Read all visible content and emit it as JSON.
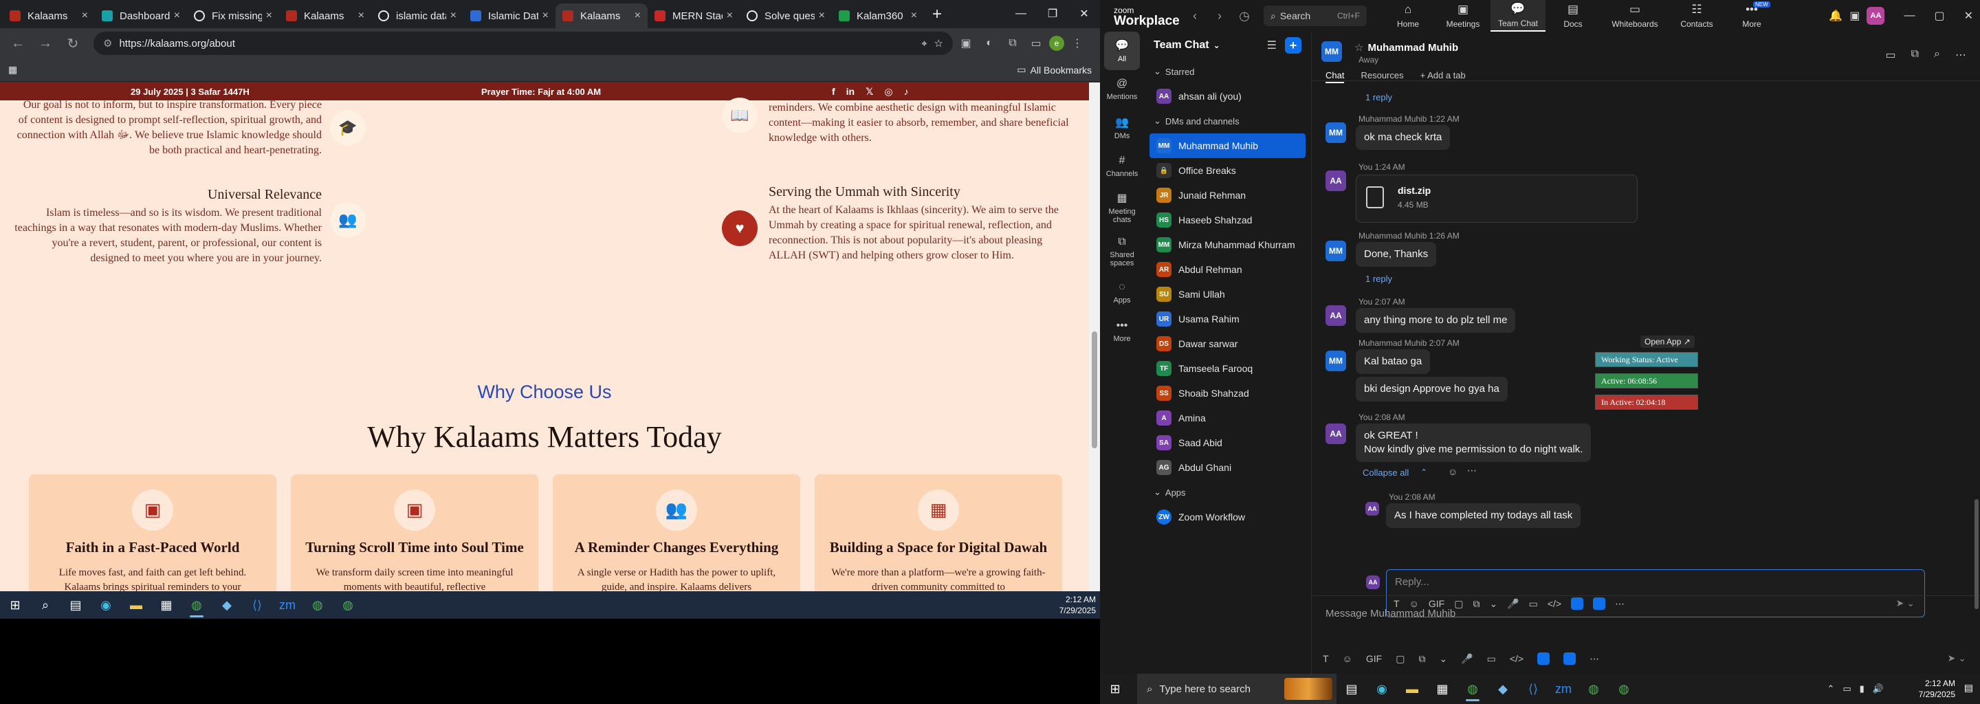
{
  "chrome": {
    "tabs": [
      {
        "label": "Kalaams",
        "favicon_color": "#b02a1e",
        "active": false
      },
      {
        "label": "Dashboard",
        "favicon_color": "#19a1a8",
        "active": false
      },
      {
        "label": "Fix missing",
        "favicon_color": "#e8eaed",
        "active": false
      },
      {
        "label": "Kalaams",
        "favicon_color": "#b02a1e",
        "active": false
      },
      {
        "label": "islamic data",
        "favicon_color": "#e8eaed",
        "active": false
      },
      {
        "label": "Islamic Data",
        "favicon_color": "#2f6bd6",
        "active": false
      },
      {
        "label": "Kalaams",
        "favicon_color": "#b02a1e",
        "active": true
      },
      {
        "label": "MERN Stack",
        "favicon_color": "#c62828",
        "active": false
      },
      {
        "label": "Solve quest",
        "favicon_color": "#e8eaed",
        "active": false
      },
      {
        "label": "Kalam360",
        "favicon_color": "#1e9e4a",
        "active": false
      }
    ],
    "url": "https://kalaams.org/about",
    "bookmarks_label": "All Bookmarks"
  },
  "site": {
    "date": "29 July 2025 | 3 Safar 1447H",
    "prayer": "Prayer Time: Fajr at 4:00 AM",
    "feature_left_top_text": "Our goal is not to inform, but to inspire transformation. Every piece of content is designed to prompt self-reflection, spiritual growth, and connection with Allah ﷻ. We believe true Islamic knowledge should be both practical and heart-penetrating.",
    "feature_right_top_text": "reminders. We combine aesthetic design with meaningful Islamic content—making it easier to absorb, remember, and share beneficial knowledge with others.",
    "universal_title": "Universal Relevance",
    "universal_text": "Islam is timeless—and so is its wisdom. We present traditional teachings in a way that resonates with modern-day Muslims. Whether you're a revert, student, parent, or professional, our content is designed to meet you where you are in your journey.",
    "serving_title": "Serving the Ummah with Sincerity",
    "serving_text": "At the heart of Kalaams is Ikhlaas (sincerity). We aim to serve the Ummah by creating a space for spiritual renewal, reflection, and reconnection. This is not about popularity—it's about pleasing ALLAH (SWT) and helping others grow closer to Him.",
    "why_choose": "Why Choose Us",
    "why_matters": "Why Kalaams Matters Today",
    "cards": [
      {
        "title": "Faith in a Fast-Paced World",
        "text": "Life moves fast, and faith can get left behind. Kalaams brings spiritual reminders to your"
      },
      {
        "title": "Turning Scroll Time into Soul Time",
        "text": "We transform daily screen time into meaningful moments with beautiful, reflective"
      },
      {
        "title": "A Reminder Changes Everything",
        "text": "A single verse or Hadith has the power to uplift, guide, and inspire. Kalaams delivers"
      },
      {
        "title": "Building a Space for Digital Dawah",
        "text": "We're more than a platform—we're a growing faith-driven community committed to"
      }
    ]
  },
  "taskbar_left": {
    "time": "2:12 AM",
    "date": "7/29/2025"
  },
  "zoom": {
    "logo_top": "zoom",
    "logo_bottom": "Workplace",
    "search_label": "Search",
    "search_kbd": "Ctrl+F",
    "nav": [
      {
        "label": "Home",
        "icon": "home-icon"
      },
      {
        "label": "Meetings",
        "icon": "meetings-icon"
      },
      {
        "label": "Team Chat",
        "icon": "chat-icon",
        "active": true
      },
      {
        "label": "Docs",
        "icon": "docs-icon"
      },
      {
        "label": "Whiteboards",
        "icon": "whiteboard-icon"
      },
      {
        "label": "Contacts",
        "icon": "contacts-icon"
      },
      {
        "label": "More",
        "icon": "more-icon",
        "badge": "NEW"
      }
    ],
    "rail": [
      {
        "label": "All",
        "active": true
      },
      {
        "label": "Mentions"
      },
      {
        "label": "DMs"
      },
      {
        "label": "Channels"
      },
      {
        "label": "Meeting chats"
      },
      {
        "label": "Shared spaces"
      },
      {
        "label": "Apps"
      },
      {
        "label": "More"
      }
    ],
    "list_title": "Team Chat",
    "sections": {
      "starred": "Starred",
      "dms": "DMs and channels",
      "apps": "Apps"
    },
    "starred": [
      {
        "name": "ahsan ali (you)",
        "initials": "AA",
        "color": "#6b3fa0"
      }
    ],
    "contacts": [
      {
        "name": "Muhammad Muhib",
        "initials": "MM",
        "color": "#1e6bd6",
        "selected": true
      },
      {
        "name": "Office Breaks",
        "initials": "🔒",
        "color": "#3a3a3a"
      },
      {
        "name": "Junaid Rehman",
        "initials": "JR",
        "color": "#c77a14"
      },
      {
        "name": "Haseeb Shahzad",
        "initials": "HS",
        "color": "#1f8a4c"
      },
      {
        "name": "Mirza Muhammad Khurram",
        "initials": "MM",
        "color": "#1f8a4c"
      },
      {
        "name": "Abdul Rehman",
        "initials": "AR",
        "color": "#c2410c"
      },
      {
        "name": "Sami Ullah",
        "initials": "SU",
        "color": "#b8860b"
      },
      {
        "name": "Usama Rahim",
        "initials": "UR",
        "color": "#2e6bd6"
      },
      {
        "name": "Dawar sarwar",
        "initials": "DS",
        "color": "#c2410c"
      },
      {
        "name": "Tamseela Farooq",
        "initials": "TF",
        "color": "#1f8a4c"
      },
      {
        "name": "Shoaib Shahzad",
        "initials": "SS",
        "color": "#c2410c"
      },
      {
        "name": "Amina",
        "initials": "A",
        "color": "#7e3fb0"
      },
      {
        "name": "Saad Abid",
        "initials": "SA",
        "color": "#7e3fb0"
      },
      {
        "name": "Abdul Ghani",
        "initials": "AG",
        "color": "#555555"
      }
    ],
    "apps": [
      {
        "name": "Zoom Workflow",
        "initials": "ZW",
        "color": "#0e71eb"
      }
    ],
    "chat": {
      "name": "Muhammad Muhib",
      "status": "Away",
      "initials": "MM",
      "tabs": [
        "Chat",
        "Resources",
        "+ Add a tab"
      ],
      "reply_1": "1 reply",
      "m1_meta": "Muhammad Muhib 1:22 AM",
      "m1_text": "ok ma check krta",
      "m2_meta": "You 1:24 AM",
      "file_name": "dist.zip",
      "file_size": "4.45 MB",
      "m3_meta": "Muhammad Muhib 1:26 AM",
      "m3_text": "Done, Thanks",
      "reply_2": "1 reply",
      "m4_meta": "You 2:07 AM",
      "m4_text": "any thing more to do plz tell me",
      "m5_meta": "Muhammad Muhib 2:07 AM",
      "m5_text1": "Kal batao ga",
      "m5_text2": "bki design Approve ho gya ha",
      "m6_meta": "You 2:08 AM",
      "m6_line1": "ok GREAT !",
      "m6_line2": "Now  kindly give me permission to do night  walk.",
      "collapse": "Collapse all",
      "t_meta": "You 2:08 AM",
      "t_text": "As I have completed my todays all task",
      "reply_placeholder": "Reply...",
      "compose_placeholder": "Message Muhammad Muhib",
      "open_app": "Open App ↗",
      "working": "Working Status: Active",
      "active": "Active: 06:08:56",
      "inactive": "In Active: 02:04:18"
    }
  },
  "taskbar_right": {
    "search": "Type here to search",
    "time": "2:12 AM",
    "date": "7/29/2025"
  }
}
